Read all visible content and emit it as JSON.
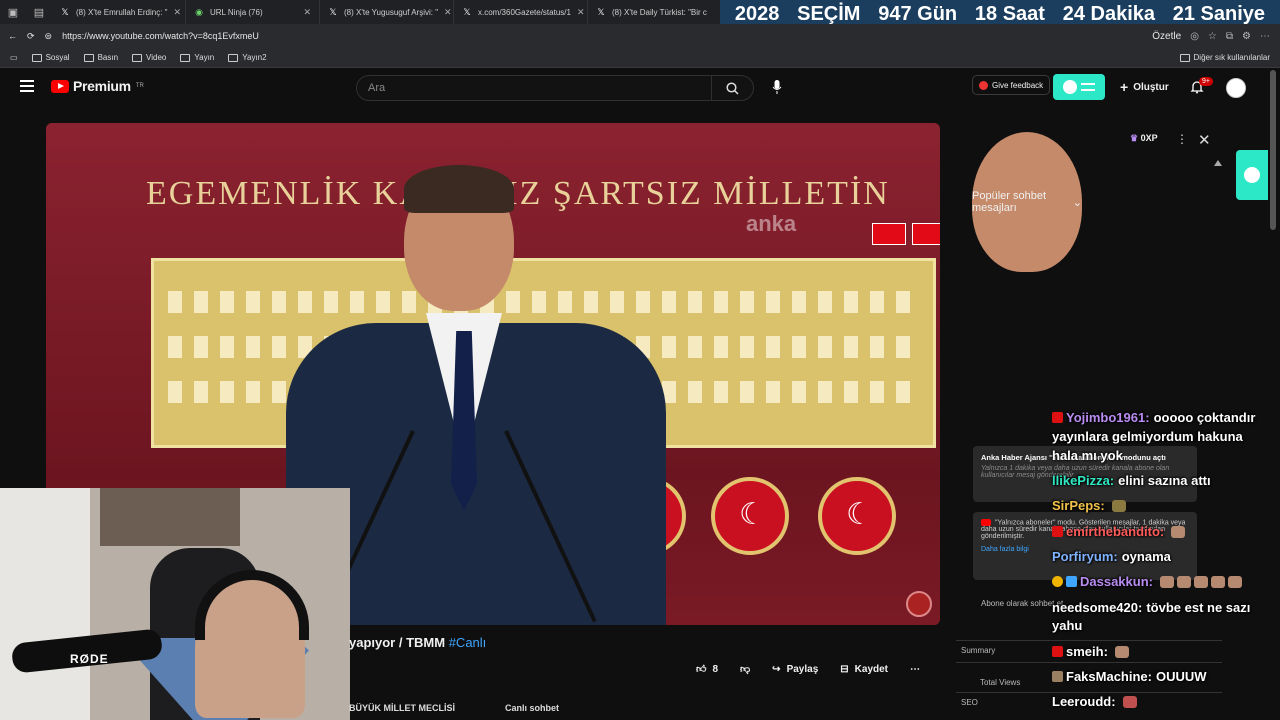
{
  "browser": {
    "tabs": [
      {
        "label": "(8) X'te Emrullah Erdinç: \"",
        "icon": "x-logo"
      },
      {
        "label": "URL Ninja (76)",
        "icon": "url-ninja"
      },
      {
        "label": "(8) X'te Yugusuguf Arşivi: \"",
        "icon": "x-logo"
      },
      {
        "label": "x.com/360Gazete/status/1",
        "icon": "x-logo"
      },
      {
        "label": "(8) X'te Daily Türkist: \"Bir c",
        "icon": "x-logo"
      }
    ],
    "url": "https://www.youtube.com/watch?v=8cq1EvfxmeU",
    "summarize_label": "Özetle",
    "bookmarks": [
      "Sosyal",
      "Basın",
      "Video",
      "Yayın",
      "Yayın2"
    ],
    "other_bookmarks": "Diğer sık kullanılanlar"
  },
  "countdown": {
    "year": "2028",
    "label": "SEÇİM",
    "days": "947 Gün",
    "hours": "18 Saat",
    "minutes": "24 Dakika",
    "seconds": "21 Saniye"
  },
  "youtube": {
    "logo_text": "Premium",
    "logo_region": "TR",
    "search_placeholder": "Ara",
    "feedback_label": "Give feedback",
    "create_label": "Oluştur",
    "notification_badge": "9+"
  },
  "video": {
    "slogan": "EGEMENLİK KAYITSIZ ŞARTSIZ MİLLETİN",
    "watermark": "anka",
    "title": "yapıyor / TBMM",
    "hashtag": "#Canlı",
    "likes": "8",
    "share_label": "Paylaş",
    "save_label": "Kaydet",
    "channel": "BÜYÜK MİLLET MECLİSİ",
    "live_chat_label": "Canlı sohbet"
  },
  "webcam": {
    "mic_brand": "RØDE"
  },
  "chat": {
    "header": "Popüler sohbet mesajları",
    "xp": "0XP",
    "system_cards": [
      {
        "title": "Anka Haber Ajansı \"Yalnızca aboneler\" modunu açtı",
        "sub": "Yalnızca 1 dakika veya daha uzun süredir kanala abone olan kullanıcılar mesaj gönderebilir"
      },
      {
        "title": "\"Yalnızca aboneler\" modu. Gösterilen mesajlar, 1 dakika veya daha uzun süredir kanala abone olan kullanıcılar tarafından gönderilmiştir.",
        "link": "Daha fazla bilgi"
      }
    ],
    "subscribe_note": "Abone olarak sohbet et",
    "stats": [
      "Summary",
      "Total Views",
      "SEO"
    ]
  },
  "overlay_chat": [
    {
      "user": "Yojimbo1961:",
      "text": "ooooo çoktandır",
      "color": "#b98cf2"
    },
    {
      "user": "",
      "text": "yayınlara gelmiyordum hakuna",
      "color": "#ffffff"
    },
    {
      "user": "",
      "text": "hala mı yok",
      "color": "#ffffff"
    },
    {
      "user": "llikePizza:",
      "text": "elini sazına attı",
      "color": "#2ee8c2"
    },
    {
      "user": "SirPeps:",
      "text": "",
      "color": "#f0c14b"
    },
    {
      "user": "emirthebandito:",
      "text": "",
      "color": "#ff5a5a"
    },
    {
      "user": "Porfiryum:",
      "text": "oynama",
      "color": "#7fb2ff"
    },
    {
      "user": "Dassakkun:",
      "text": "",
      "color": "#b98cf2"
    },
    {
      "user": "needsome420:",
      "text": "tövbe est ne sazı",
      "color": "#ffffff"
    },
    {
      "user": "",
      "text": "yahu",
      "color": "#ffffff"
    },
    {
      "user": "smeih:",
      "text": "",
      "color": "#ffffff"
    },
    {
      "user": "FaksMachine:",
      "text": "OUUUW",
      "color": "#ffffff"
    },
    {
      "user": "Leeroudd:",
      "text": "",
      "color": "#ffffff"
    }
  ]
}
